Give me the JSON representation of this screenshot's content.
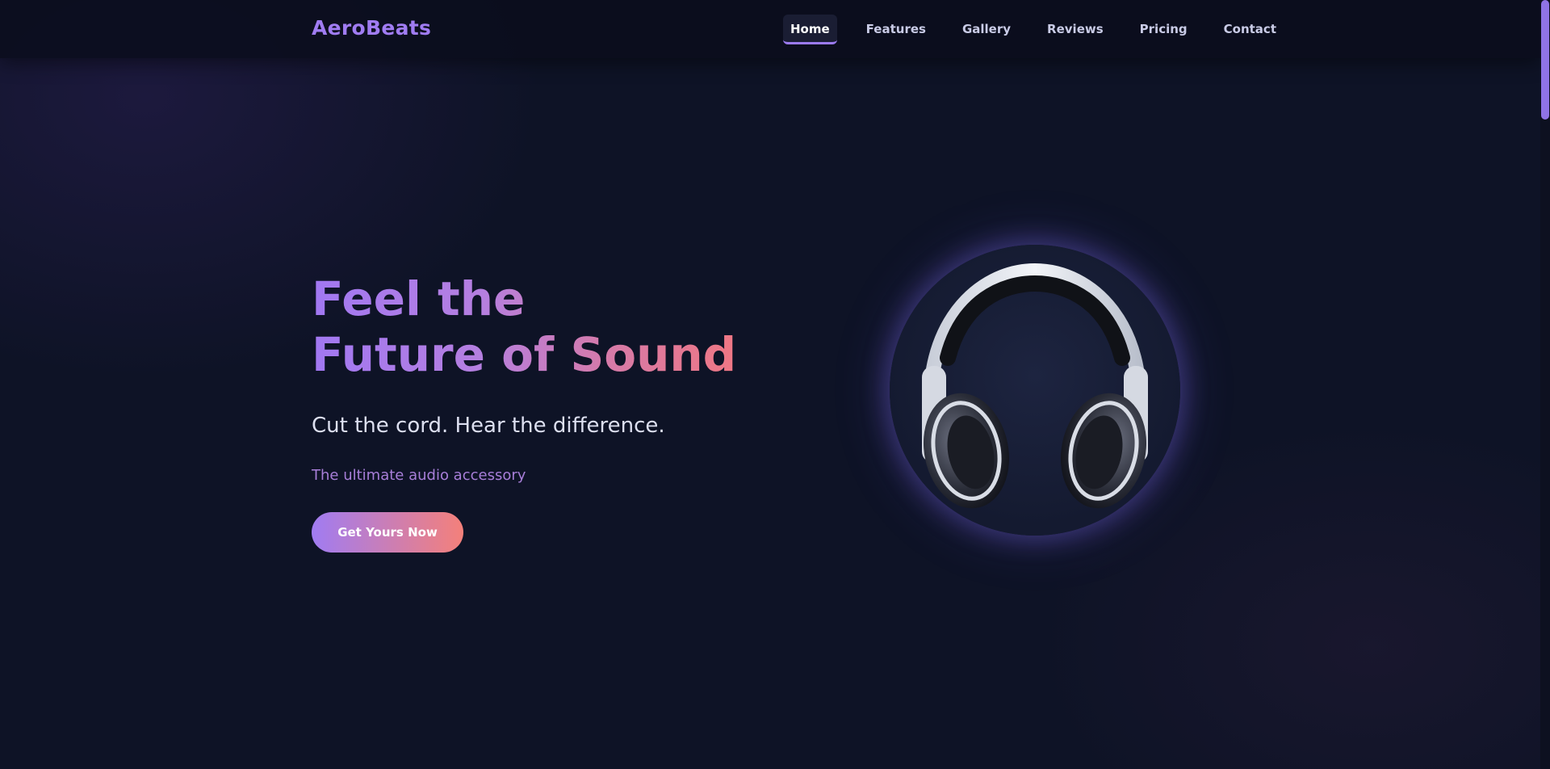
{
  "brand": {
    "logo_text": "AeroBeats"
  },
  "nav": {
    "items": [
      {
        "label": "Home",
        "active": true
      },
      {
        "label": "Features",
        "active": false
      },
      {
        "label": "Gallery",
        "active": false
      },
      {
        "label": "Reviews",
        "active": false
      },
      {
        "label": "Pricing",
        "active": false
      },
      {
        "label": "Contact",
        "active": false
      }
    ]
  },
  "hero": {
    "title_line1": "Feel the",
    "title_line2": "Future of Sound",
    "subtitle": "Cut the cord. Hear the difference.",
    "tagline": "The ultimate audio accessory",
    "cta_label": "Get Yours Now",
    "product_image_icon": "headphones-icon"
  },
  "colors": {
    "accent_purple": "#a07cf2",
    "accent_coral": "#f4807a",
    "background": "#0e1326"
  }
}
